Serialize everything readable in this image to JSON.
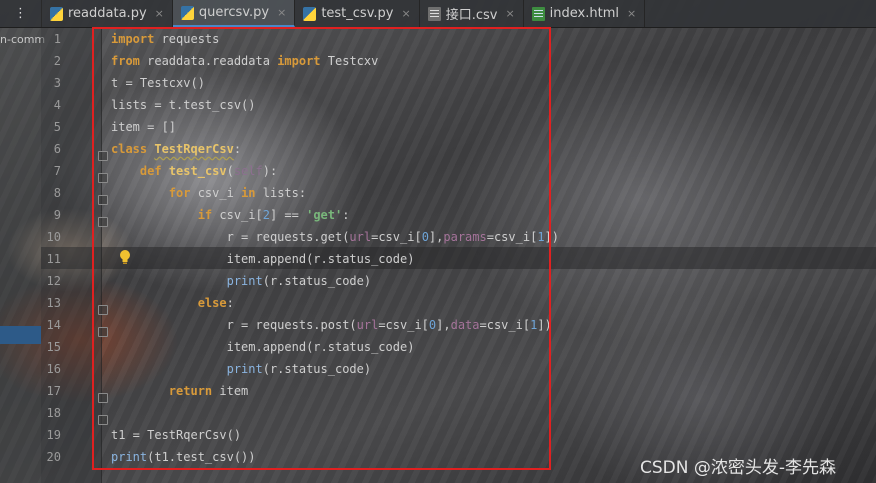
{
  "tabs": [
    {
      "label": "readdata.py",
      "icon": "python-file-icon",
      "active": false
    },
    {
      "label": "quercsv.py",
      "icon": "python-file-icon",
      "active": true
    },
    {
      "label": "test_csv.py",
      "icon": "python-file-icon",
      "active": false
    },
    {
      "label": "接口.csv",
      "icon": "csv-file-icon",
      "active": false
    },
    {
      "label": "index.html",
      "icon": "html-file-icon",
      "active": false
    }
  ],
  "close_glyph": "×",
  "project_panel": {
    "text": "n-comm"
  },
  "line_numbers": [
    "1",
    "2",
    "3",
    "4",
    "5",
    "6",
    "7",
    "8",
    "9",
    "10",
    "11",
    "12",
    "13",
    "14",
    "15",
    "16",
    "17",
    "18",
    "19",
    "20"
  ],
  "code_lines": [
    "import requests",
    "from readdata.readdata import Testcxv",
    "t = Testcxv()",
    "lists = t.test_csv()",
    "item = []",
    "class TestRqerCsv:",
    "    def test_csv(self):",
    "        for csv_i in lists:",
    "            if csv_i[2] == 'get':",
    "                r = requests.get(url=csv_i[0],params=csv_i[1])",
    "                item.append(r.status_code)",
    "                print(r.status_code)",
    "            else:",
    "                r = requests.post(url=csv_i[0],data=csv_i[1])",
    "                item.append(r.status_code)",
    "                print(r.status_code)",
    "        return item",
    "",
    "t1 = TestRqerCsv()",
    "print(t1.test_csv())"
  ],
  "current_line": "11",
  "watermark": "CSDN @浓密头发-李先森",
  "colors": {
    "highlight_box": "#e02020",
    "keyword": "#d89a3a",
    "string": "#79b77b",
    "number": "#6fa5d8"
  }
}
